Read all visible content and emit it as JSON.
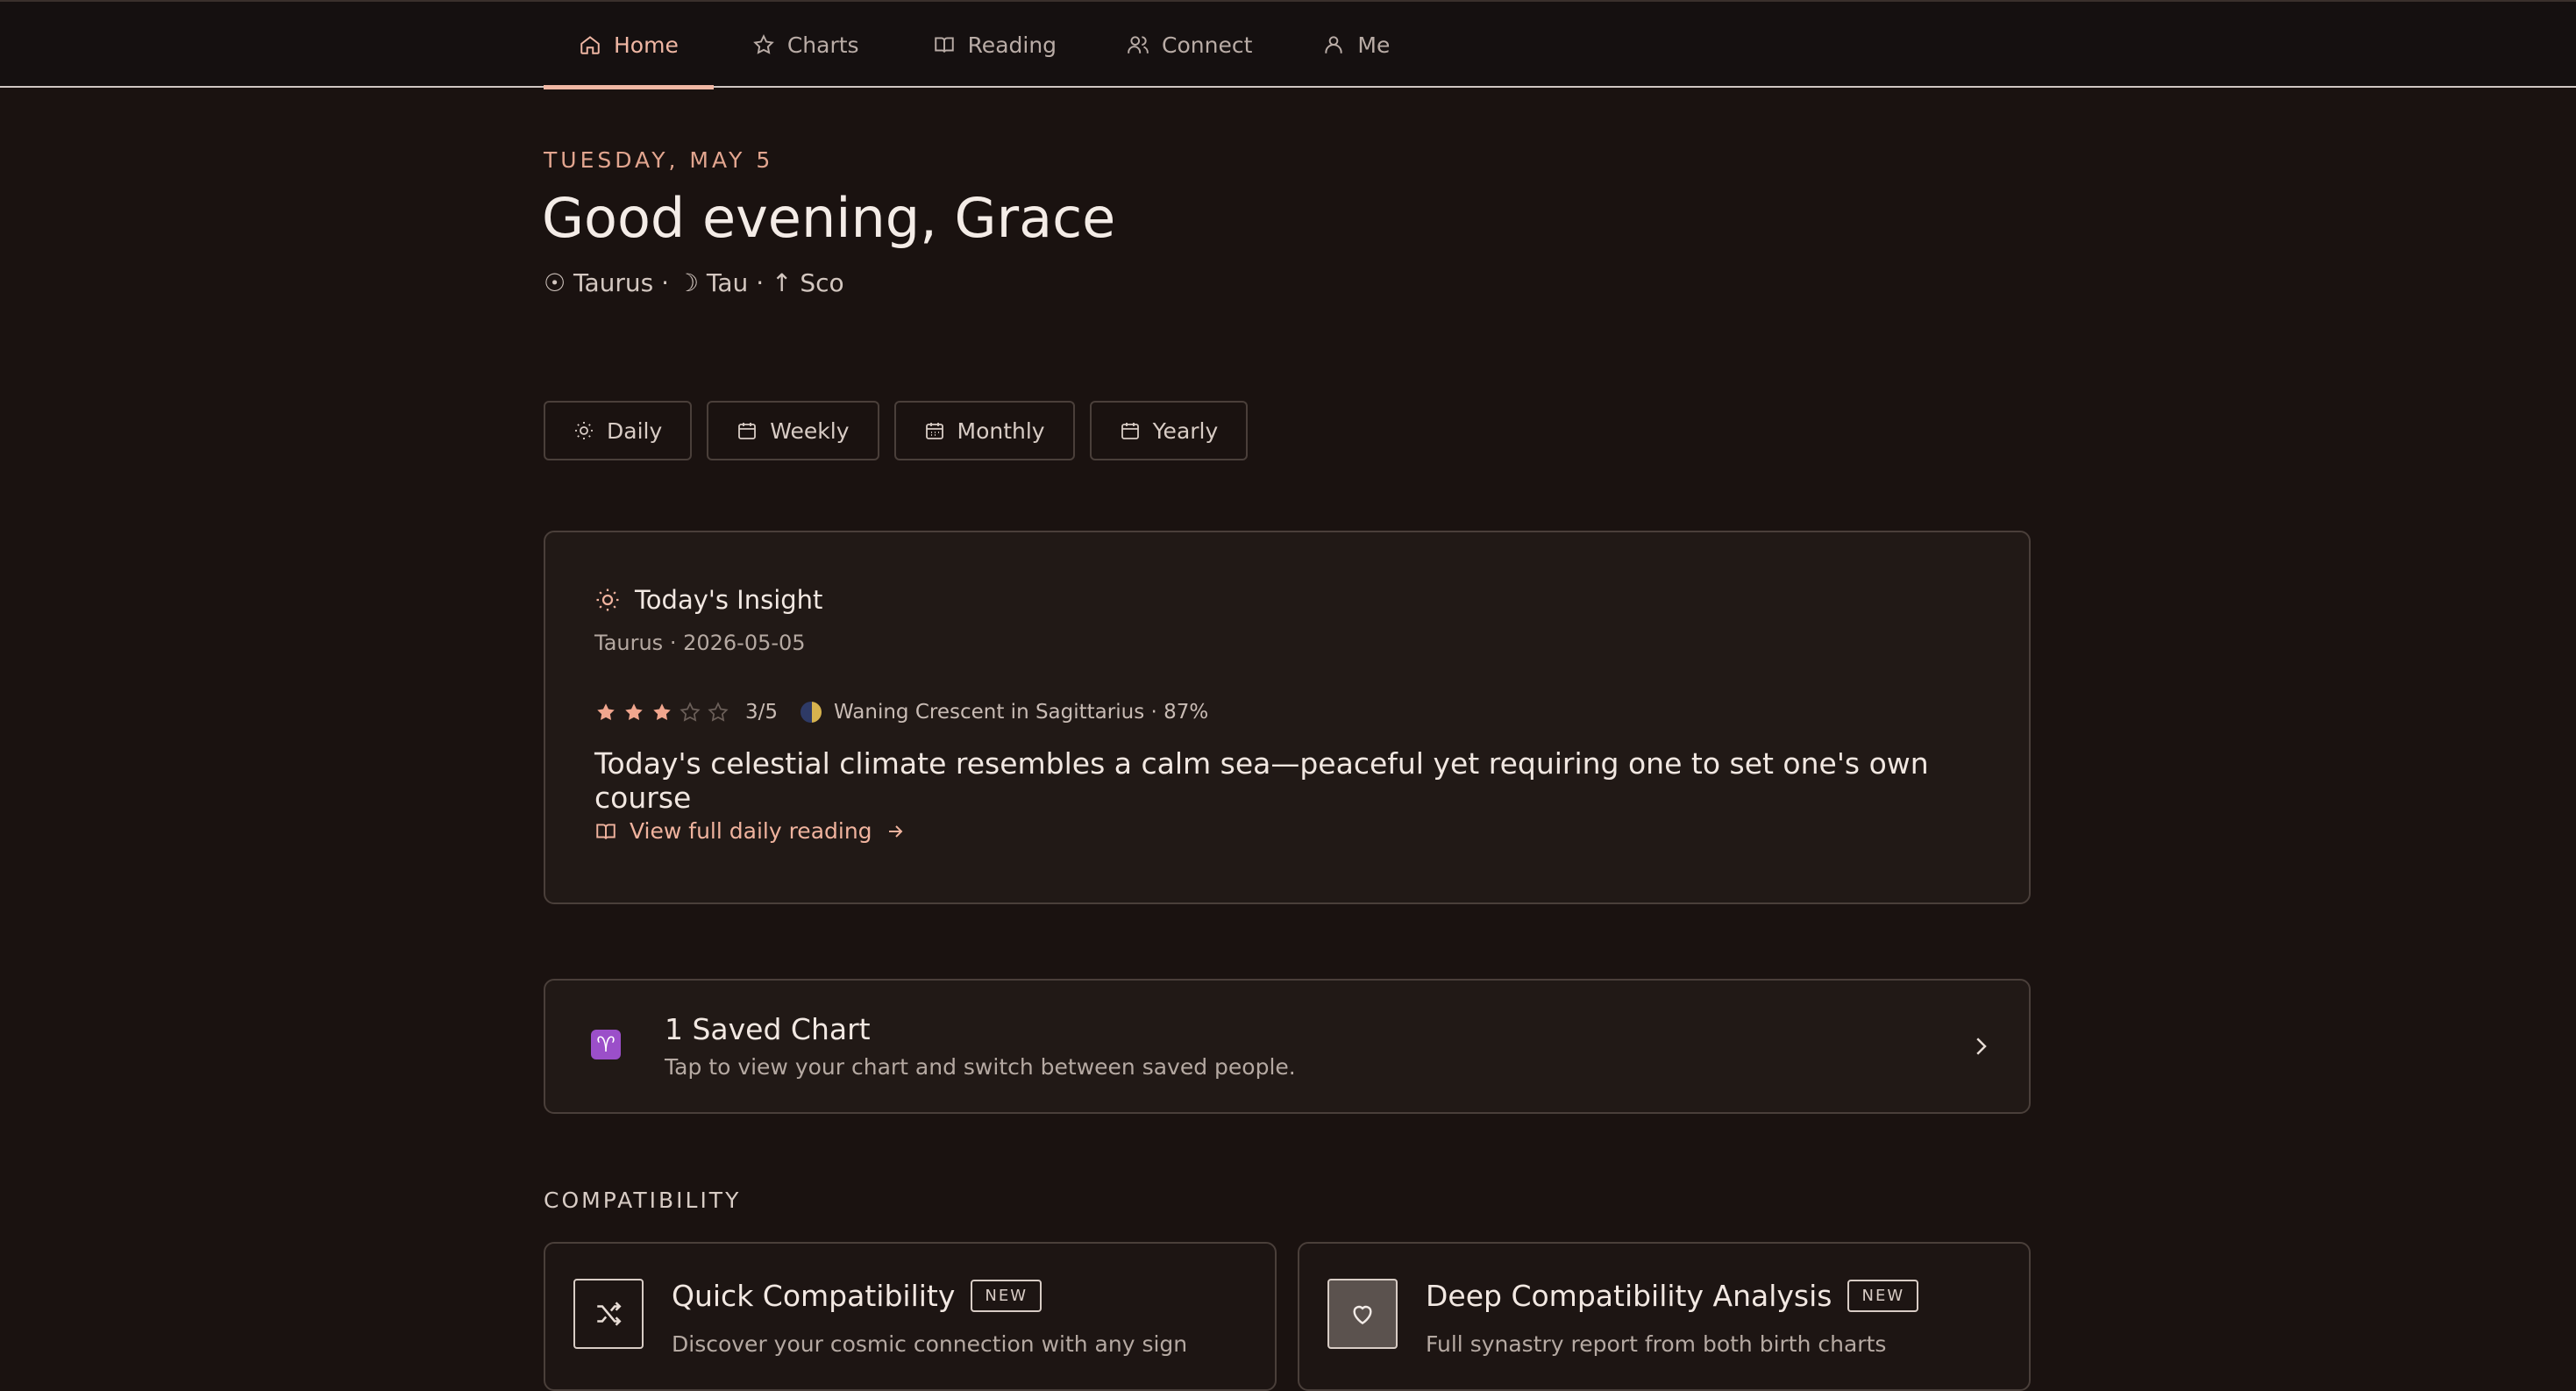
{
  "nav": {
    "items": [
      {
        "label": "Home",
        "icon": "home-icon",
        "active": true
      },
      {
        "label": "Charts",
        "icon": "star-icon"
      },
      {
        "label": "Reading",
        "icon": "book-icon"
      },
      {
        "label": "Connect",
        "icon": "users-icon"
      },
      {
        "label": "Me",
        "icon": "user-icon"
      }
    ]
  },
  "header": {
    "date": "TUESDAY, MAY 5",
    "greeting": "Good evening, Grace",
    "signs": "☉ Taurus · ☽ Tau · ↑ Sco"
  },
  "periods": [
    "Daily",
    "Weekly",
    "Monthly",
    "Yearly"
  ],
  "insight": {
    "title": "Today's Insight",
    "subtitle": "Taurus · 2026-05-05",
    "rating": 3,
    "rating_max": 5,
    "rating_text": "3/5",
    "moon_text": "Waning Crescent in Sagittarius · 87%",
    "summary": "Today's celestial climate resembles a calm sea—peaceful yet requiring one to set one's own course",
    "link": "View full daily reading"
  },
  "saved": {
    "badge": "♈",
    "title": "1 Saved Chart",
    "subtitle": "Tap to view your chart and switch between saved people."
  },
  "compatibility": {
    "section_title": "COMPATIBILITY",
    "quick": {
      "title": "Quick Compatibility",
      "badge": "NEW",
      "subtitle": "Discover your cosmic connection with any sign"
    },
    "deep": {
      "title": "Deep Compatibility Analysis",
      "badge": "NEW",
      "subtitle": "Full synastry report from both birth charts"
    }
  },
  "colors": {
    "accent": "#f0b7a4",
    "background": "#1a1210",
    "card": "#211916",
    "star": "#f1a68e"
  }
}
